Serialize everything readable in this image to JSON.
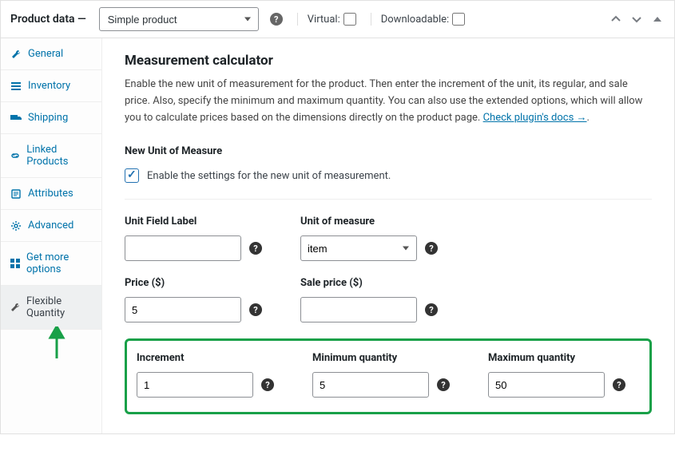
{
  "header": {
    "title": "Product data —",
    "product_type": "Simple product",
    "virtual_label": "Virtual:",
    "downloadable_label": "Downloadable:"
  },
  "sidebar": {
    "items": [
      {
        "label": "General",
        "icon": "wrench"
      },
      {
        "label": "Inventory",
        "icon": "list"
      },
      {
        "label": "Shipping",
        "icon": "truck"
      },
      {
        "label": "Linked Products",
        "icon": "link"
      },
      {
        "label": "Attributes",
        "icon": "note"
      },
      {
        "label": "Advanced",
        "icon": "gear"
      },
      {
        "label": "Get more options",
        "icon": "grid"
      },
      {
        "label": "Flexible Quantity",
        "icon": "wrench"
      }
    ],
    "active_index": 7
  },
  "main": {
    "heading": "Measurement calculator",
    "description_before": "Enable the new unit of measurement for the product. Then enter the increment of the unit, its regular, and sale price. Also, specify the minimum and maximum quantity. You can also use the extended options, which will allow you to calculate prices based on the dimensions directly on the product page. ",
    "docs_link": "Check plugin's docs →",
    "section_label": "New Unit of Measure",
    "enable_label": "Enable the settings for the new unit of measurement.",
    "enable_checked": true,
    "fields": {
      "unit_field_label": {
        "label": "Unit Field Label",
        "value": ""
      },
      "unit_of_measure": {
        "label": "Unit of measure",
        "value": "item"
      },
      "price": {
        "label": "Price ($)",
        "value": "5"
      },
      "sale_price": {
        "label": "Sale price ($)",
        "value": ""
      },
      "increment": {
        "label": "Increment",
        "value": "1"
      },
      "minimum_quantity": {
        "label": "Minimum quantity",
        "value": "5"
      },
      "maximum_quantity": {
        "label": "Maximum quantity",
        "value": "50"
      }
    }
  }
}
